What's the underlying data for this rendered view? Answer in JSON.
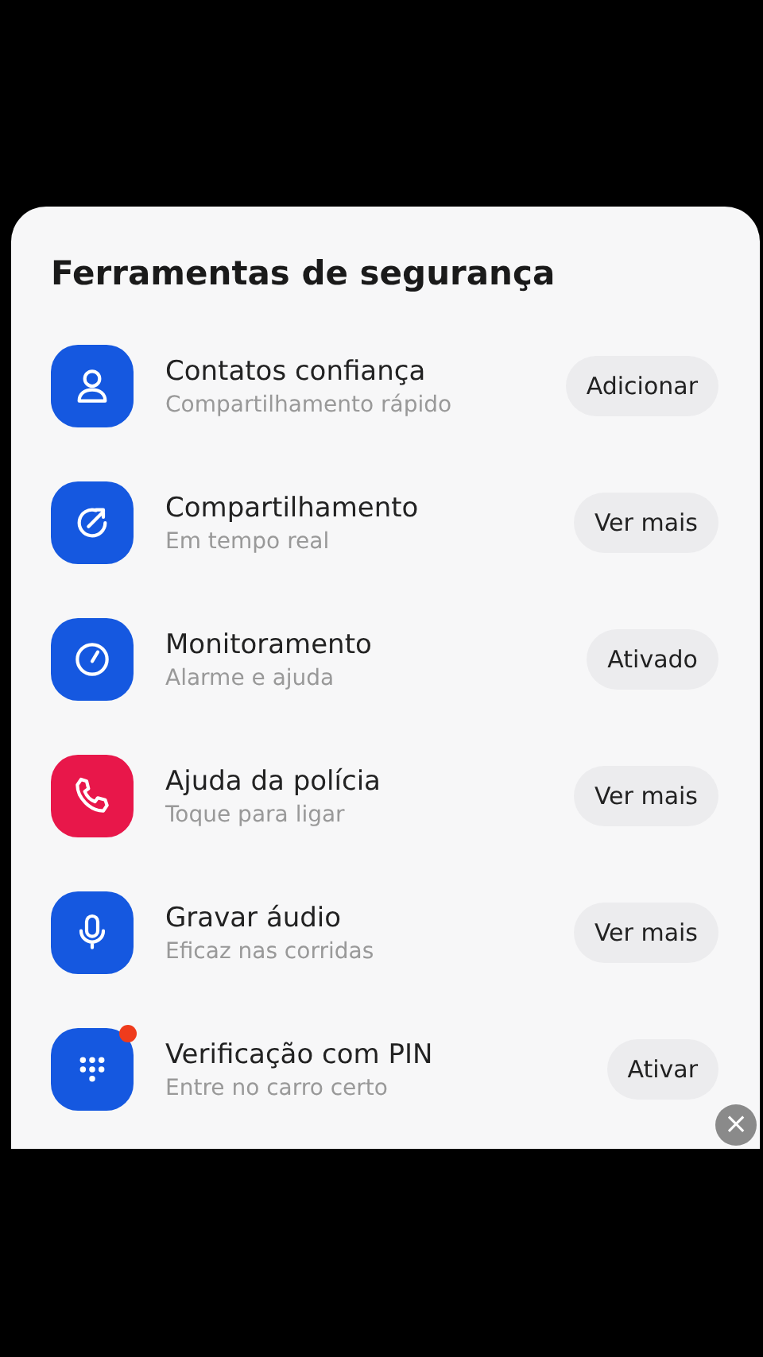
{
  "sheet": {
    "title": "Ferramentas de segurança"
  },
  "items": [
    {
      "kind": "person",
      "color": "#1558e0",
      "title": "Contatos confiança",
      "subtitle": "Compartilhamento rápido",
      "action": "Adicionar",
      "badge": false
    },
    {
      "kind": "share",
      "color": "#1558e0",
      "title": "Compartilhamento",
      "subtitle": "Em tempo real",
      "action": "Ver mais",
      "badge": false
    },
    {
      "kind": "gauge",
      "color": "#1558e0",
      "title": "Monitoramento",
      "subtitle": "Alarme e ajuda",
      "action": "Ativado",
      "badge": false
    },
    {
      "kind": "phone",
      "color": "#e8174a",
      "title": "Ajuda da polícia",
      "subtitle": "Toque para ligar",
      "action": "Ver mais",
      "badge": false
    },
    {
      "kind": "mic",
      "color": "#1558e0",
      "title": "Gravar áudio",
      "subtitle": "Eficaz nas corridas",
      "action": "Ver mais",
      "badge": false
    },
    {
      "kind": "keypad",
      "color": "#1558e0",
      "title": "Verificação com PIN",
      "subtitle": "Entre no carro certo",
      "action": "Ativar",
      "badge": true
    }
  ],
  "close": {
    "label": "×"
  }
}
